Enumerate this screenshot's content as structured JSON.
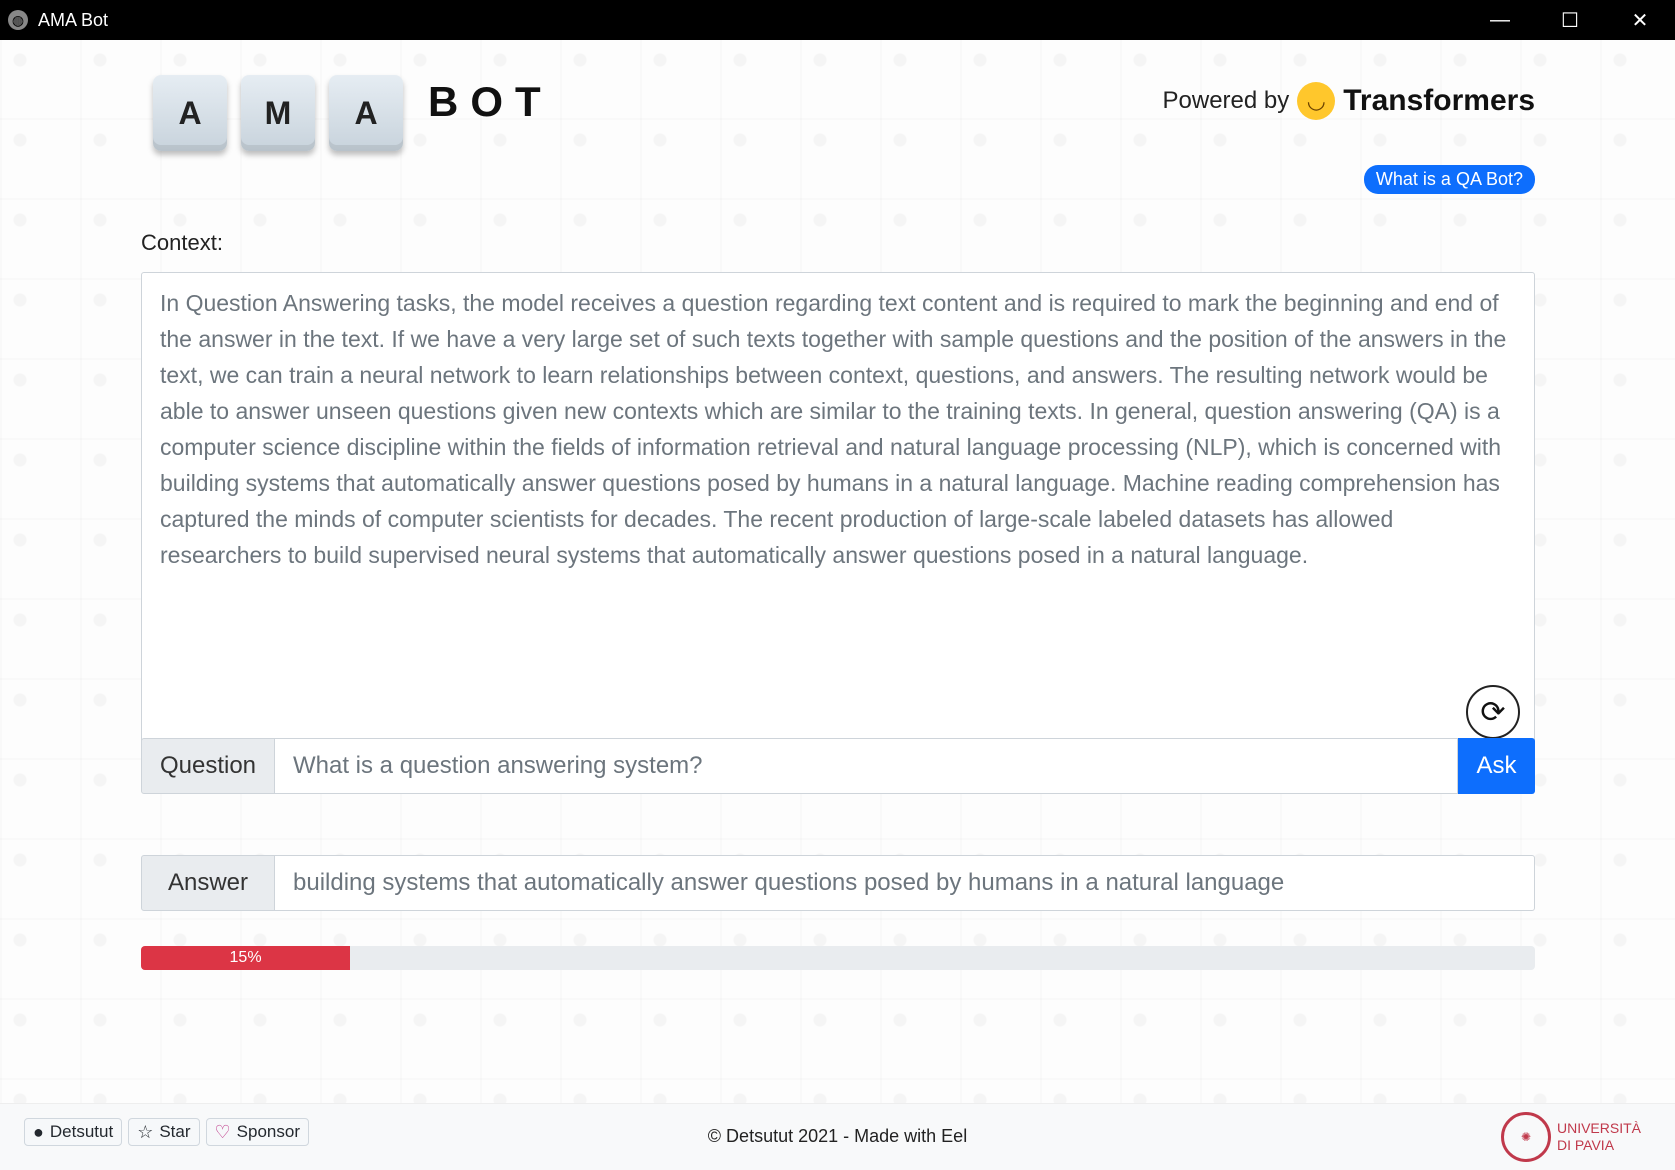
{
  "window": {
    "title": "AMA Bot",
    "icon": "globe-icon",
    "controls": {
      "minimize": "—",
      "maximize": "☐",
      "close": "✕"
    }
  },
  "header": {
    "keys": [
      "A",
      "M",
      "A"
    ],
    "bot_title": "BOT",
    "powered_label": "Powered by",
    "brand": "Transformers",
    "brand_icon": "hugging-face-icon",
    "qa_badge": "What is a QA Bot?"
  },
  "context": {
    "label": "Context:",
    "text": "In Question Answering tasks, the model receives a question regarding text content and is required to mark the beginning and end of the answer in the text. If we have a very large set of such texts together with sample questions and the position of the answers in the text, we can train a neural network to learn relationships between context, questions, and answers. The resulting network would be able to answer unseen questions given new contexts which are similar to the training texts. In general, question answering (QA) is a computer science discipline within the fields of information retrieval and natural language processing (NLP), which is concerned with building systems that automatically answer questions posed by humans in a natural language. Machine reading comprehension has captured the minds of computer scientists for decades. The recent production of large-scale labeled datasets has allowed researchers to build supervised neural systems that automatically answer questions posed in a natural language."
  },
  "question": {
    "label": "Question",
    "value": "What is a question answering system?",
    "ask_label": "Ask"
  },
  "answer": {
    "label": "Answer",
    "value": "building systems that automatically answer questions posed by humans in a natural language"
  },
  "progress": {
    "label": "15%",
    "fraction": 0.15,
    "color": "#dc3545"
  },
  "footer": {
    "github_user": "Detsutut",
    "star_label": "Star",
    "sponsor_label": "Sponsor",
    "copyright": "© Detsutut 2021 - Made with Eel",
    "university_line1": "UNIVERSITÀ",
    "university_line2": "DI PAVIA"
  },
  "colors": {
    "accent": "#0d6efd",
    "progress": "#dc3545",
    "university": "#c0394b"
  }
}
